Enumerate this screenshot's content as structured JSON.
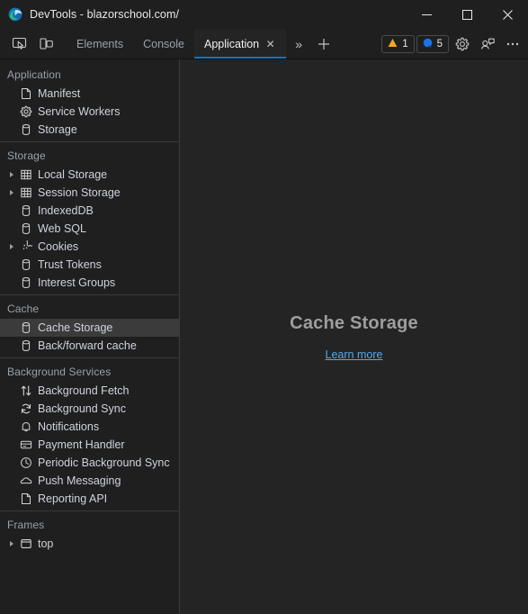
{
  "window": {
    "title": "DevTools - blazorschool.com/",
    "logo_icon": "edge-logo-icon",
    "minimize_label": "─",
    "maximize_label": "☐",
    "close_label": "✕"
  },
  "toolbar": {
    "inspect_icon": "inspect-element-icon",
    "device_icon": "device-toolbar-icon",
    "more_tabs_label": "»",
    "new_tab_label": "+",
    "warning_badge": {
      "icon": "warning-triangle-icon",
      "count": "1",
      "color": "#f5a623"
    },
    "issues_badge": {
      "icon": "issue-circle-icon",
      "count": "5",
      "color": "#1a73e8"
    },
    "settings_icon": "gear-icon",
    "feedback_icon": "feedback-icon",
    "more_options_icon": "ellipsis-icon"
  },
  "tabs": [
    {
      "label": "Elements",
      "active": false,
      "closable": false
    },
    {
      "label": "Console",
      "active": false,
      "closable": false
    },
    {
      "label": "Application",
      "active": true,
      "closable": true,
      "close_label": "✕"
    }
  ],
  "sidebar": {
    "sections": [
      {
        "title": "Application",
        "items": [
          {
            "label": "Manifest",
            "icon": "document-icon",
            "expandable": false,
            "selected": false
          },
          {
            "label": "Service Workers",
            "icon": "gear-icon",
            "expandable": false,
            "selected": false
          },
          {
            "label": "Storage",
            "icon": "database-icon",
            "expandable": false,
            "selected": false
          }
        ]
      },
      {
        "title": "Storage",
        "items": [
          {
            "label": "Local Storage",
            "icon": "table-icon",
            "expandable": true,
            "selected": false
          },
          {
            "label": "Session Storage",
            "icon": "table-icon",
            "expandable": true,
            "selected": false
          },
          {
            "label": "IndexedDB",
            "icon": "database-icon",
            "expandable": false,
            "selected": false
          },
          {
            "label": "Web SQL",
            "icon": "database-icon",
            "expandable": false,
            "selected": false
          },
          {
            "label": "Cookies",
            "icon": "cookie-icon",
            "expandable": true,
            "selected": false
          },
          {
            "label": "Trust Tokens",
            "icon": "database-icon",
            "expandable": false,
            "selected": false
          },
          {
            "label": "Interest Groups",
            "icon": "database-icon",
            "expandable": false,
            "selected": false
          }
        ]
      },
      {
        "title": "Cache",
        "items": [
          {
            "label": "Cache Storage",
            "icon": "database-icon",
            "expandable": false,
            "selected": true
          },
          {
            "label": "Back/forward cache",
            "icon": "database-icon",
            "expandable": false,
            "selected": false
          }
        ]
      },
      {
        "title": "Background Services",
        "items": [
          {
            "label": "Background Fetch",
            "icon": "updown-arrows-icon",
            "expandable": false,
            "selected": false
          },
          {
            "label": "Background Sync",
            "icon": "sync-icon",
            "expandable": false,
            "selected": false
          },
          {
            "label": "Notifications",
            "icon": "bell-icon",
            "expandable": false,
            "selected": false
          },
          {
            "label": "Payment Handler",
            "icon": "credit-card-icon",
            "expandable": false,
            "selected": false
          },
          {
            "label": "Periodic Background Sync",
            "icon": "clock-icon",
            "expandable": false,
            "selected": false
          },
          {
            "label": "Push Messaging",
            "icon": "cloud-icon",
            "expandable": false,
            "selected": false
          },
          {
            "label": "Reporting API",
            "icon": "document-icon",
            "expandable": false,
            "selected": false
          }
        ]
      },
      {
        "title": "Frames",
        "items": [
          {
            "label": "top",
            "icon": "frame-icon",
            "expandable": true,
            "selected": false
          }
        ]
      }
    ]
  },
  "panel": {
    "title": "Cache Storage",
    "link": "Learn more"
  },
  "colors": {
    "accent": "#0a76c8",
    "link": "#5ba7e5",
    "warning": "#f5a623",
    "issue": "#1a73e8",
    "sidebar_bg": "#1f1f1f",
    "panel_bg": "#242424",
    "selected_row": "#3b3b3b"
  }
}
